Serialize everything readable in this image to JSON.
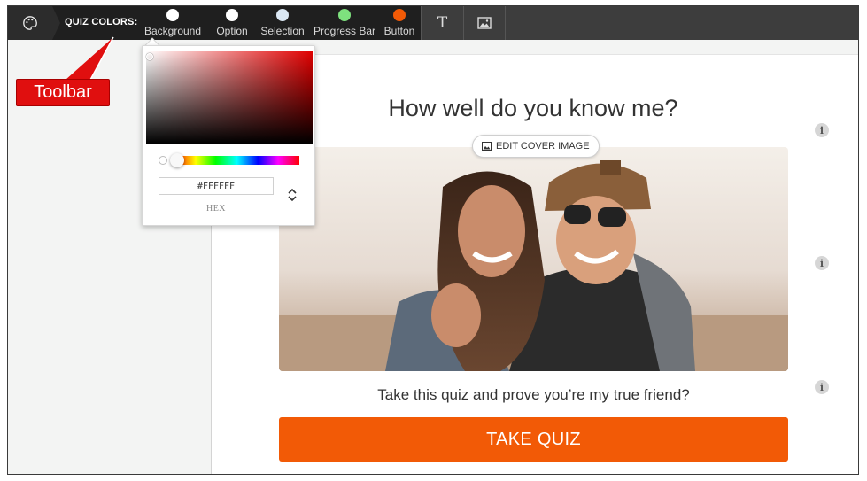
{
  "toolbar": {
    "quiz_colors_label": "QUIZ COLORS:",
    "swatches": [
      {
        "label": "Background",
        "color": "#ffffff"
      },
      {
        "label": "Option",
        "color": "#ffffff"
      },
      {
        "label": "Selection",
        "color": "#dbe8f4"
      },
      {
        "label": "Progress Bar",
        "color": "#7ee27e"
      },
      {
        "label": "Button",
        "color": "#f25a06"
      }
    ],
    "tools": [
      {
        "icon": "text-icon",
        "glyph": "T"
      },
      {
        "icon": "image-icon"
      }
    ],
    "palette_icon": "palette-icon"
  },
  "callout": {
    "label": "Toolbar",
    "color": "#e00f0f"
  },
  "color_picker": {
    "hex_value": "#FFFFFF",
    "format_label": "HEX",
    "hue_color": "#e00000"
  },
  "quiz": {
    "title": "How well do you know me?",
    "edit_cover_label": "EDIT COVER IMAGE",
    "subtitle": "Take this quiz and prove you’re my true friend?",
    "cta_label": "TAKE QUIZ",
    "cta_color": "#f25a06",
    "info_glyph": "i"
  }
}
